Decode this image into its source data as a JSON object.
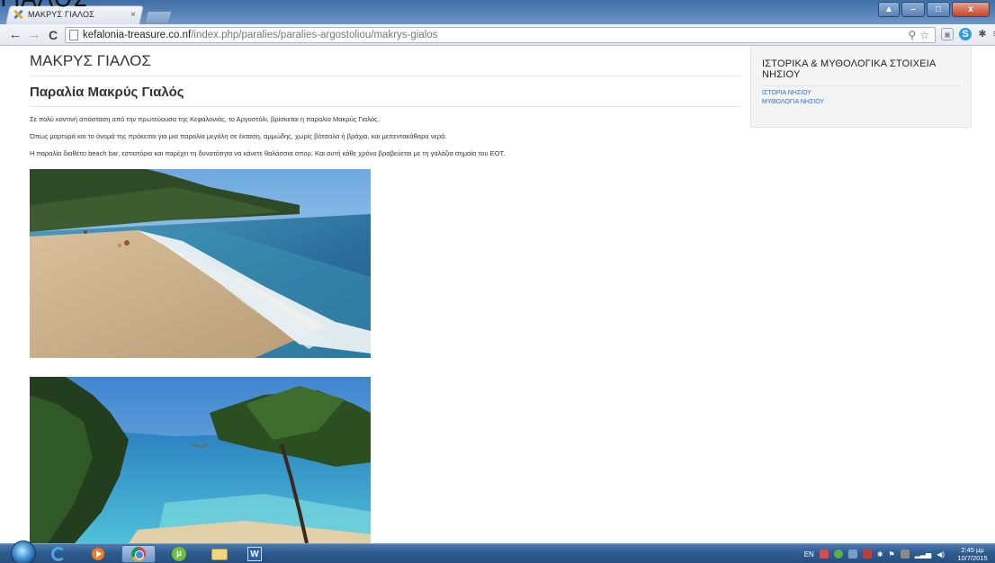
{
  "overlay": {
    "text": "ΓΙΑΛΟΣ"
  },
  "browser": {
    "tab": {
      "title": "ΜΑΚΡΥΣ ΓΙΑΛΟΣ",
      "close_label": "×"
    },
    "url_host": "kefalonia-treasure.co.nf",
    "url_path": "/index.php/paralies/paralies-argostoliou/makrys-gialos",
    "window_controls": {
      "minimize": "–",
      "maximize": "□",
      "close": "x"
    }
  },
  "page": {
    "title": "ΜΑΚΡΥΣ ΓΙΑΛΟΣ",
    "article_title": "Παραλία Μακρύς Γιαλός",
    "paragraphs": [
      "Σε πολύ κοντινή απόσταση από την πρωτεύουσα της Κεφαλονιάς, το Αργοστόλι, βρίσκεται η παραλία Μακρύς Γιαλός.",
      "Όπως μαρτυρά και το όνομά της πρόκειται για μια παραλία μεγάλη σε έκταση, αμμώδης, χωρίς βότσαλα ή βράχια, και μεπεντακάθαρα νερά.",
      "Η παραλία διαθέτει beach bar, εστιατόριο και παρέχει τη δυνατότητα να κάνετε θαλάσσια σπορ.  Και αυτή κάθε χρόνο βραβεύεται με τη γαλάζια σημαία του ΕΟΤ."
    ]
  },
  "sidebar": {
    "heading": "ΙΣΤΟΡΙΚΑ & ΜΥΘΟΛΟΓΙΚΑ ΣΤΟΙΧΕΙΑ ΝΗΣΙΟΥ",
    "links": [
      "ΙΣΤΟΡΙΑ ΝΗΣΙΟΥ",
      "ΜΥΘΟΛΟΓΙΑ ΝΗΣΙΟΥ"
    ]
  },
  "taskbar": {
    "language": "EN",
    "clock_time": "2:45 μμ",
    "clock_date": "10/7/2015",
    "word_label": "W"
  }
}
